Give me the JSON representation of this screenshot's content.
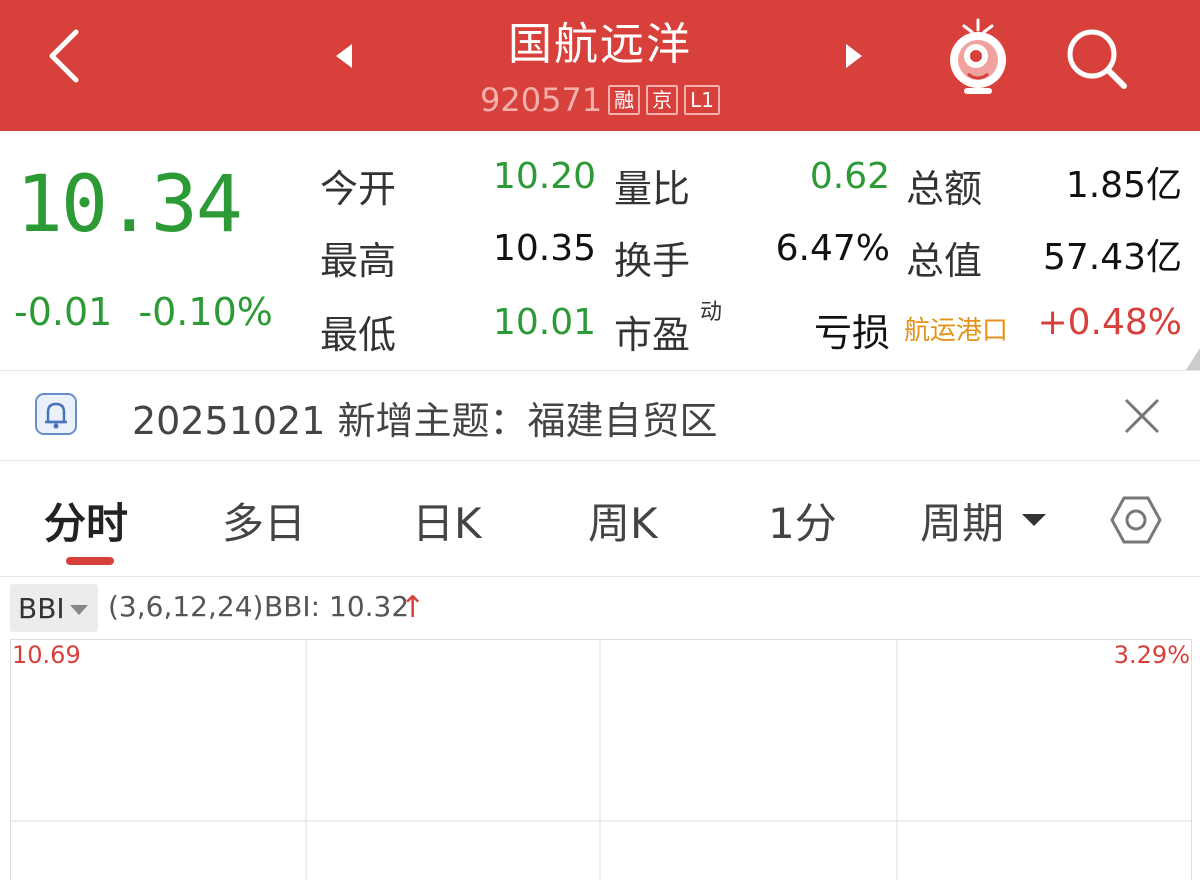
{
  "header": {
    "stock_name": "国航远洋",
    "stock_code": "920571",
    "tags": [
      "融",
      "京",
      "L1"
    ],
    "bg_color": "#d8403b"
  },
  "quote": {
    "last_price": "10.34",
    "change": "-0.01",
    "change_pct": "-0.10%",
    "fields": {
      "open_label": "今开",
      "open": "10.20",
      "high_label": "最高",
      "high": "10.35",
      "low_label": "最低",
      "low": "10.01",
      "vol_ratio_label": "量比",
      "vol_ratio": "0.62",
      "turnover_label": "换手",
      "turnover": "6.47%",
      "pe_label": "市盈",
      "pe_sup": "动",
      "pe": "亏损",
      "amount_label": "总额",
      "amount": "1.85亿",
      "mktcap_label": "总值",
      "mktcap": "57.43亿",
      "sector": "航运港口",
      "sector_pct": "+0.48%"
    },
    "colors": {
      "down": "#2c9a35",
      "up": "#d8403b",
      "sector": "#e3931a"
    }
  },
  "notice": {
    "text": "20251021 新增主题：福建自贸区",
    "icon": "bell-icon"
  },
  "tabs": [
    {
      "label": "分时",
      "active": true
    },
    {
      "label": "多日",
      "active": false
    },
    {
      "label": "日K",
      "active": false
    },
    {
      "label": "周K",
      "active": false
    },
    {
      "label": "1分",
      "active": false
    },
    {
      "label": "周期",
      "active": false
    }
  ],
  "indicator": {
    "name": "BBI",
    "params": "(3,6,12,24)",
    "value_text": "BBI: 10.32",
    "arrow": "↑"
  },
  "chart": {
    "max_price": "10.69",
    "max_pct": "3.29%"
  }
}
